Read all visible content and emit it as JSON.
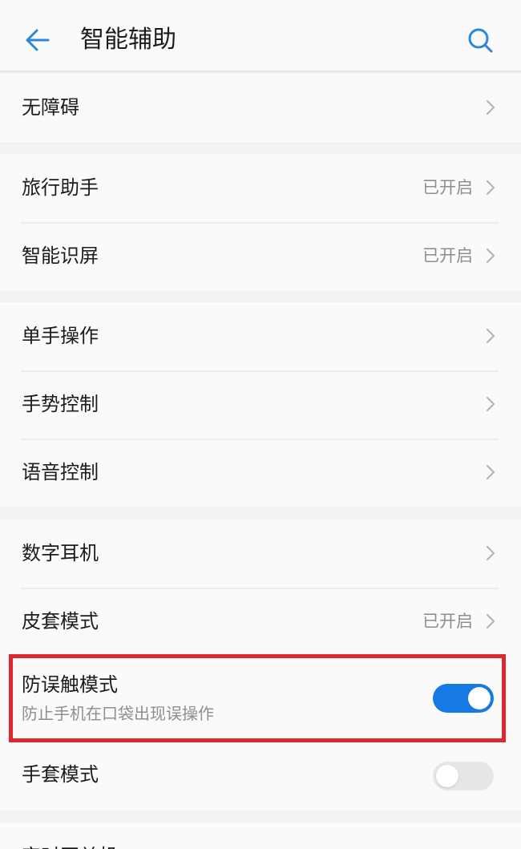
{
  "header": {
    "title": "智能辅助",
    "back_icon": "back-arrow-icon",
    "search_icon": "search-icon",
    "accent_color": "#2a87d9"
  },
  "groups": [
    {
      "items": [
        {
          "label": "无障碍",
          "status": ""
        }
      ]
    },
    {
      "items": [
        {
          "label": "旅行助手",
          "status": "已开启"
        },
        {
          "label": "智能识屏",
          "status": "已开启"
        }
      ]
    },
    {
      "items": [
        {
          "label": "单手操作",
          "status": ""
        },
        {
          "label": "手势控制",
          "status": ""
        },
        {
          "label": "语音控制",
          "status": ""
        }
      ]
    },
    {
      "items": [
        {
          "label": "数字耳机",
          "status": ""
        },
        {
          "label": "皮套模式",
          "status": "已开启"
        }
      ],
      "pocket_mode": {
        "label": "防误触模式",
        "subtitle": "防止手机在口袋出现误操作",
        "enabled": true
      },
      "glove_mode": {
        "label": "手套模式",
        "enabled": false
      }
    },
    {
      "items": [
        {
          "label": "定时开关机",
          "status": ""
        }
      ]
    }
  ],
  "colors": {
    "toggle_on": "#1679e4",
    "toggle_off": "#e6e6e6",
    "highlight_border": "#e0262d"
  }
}
